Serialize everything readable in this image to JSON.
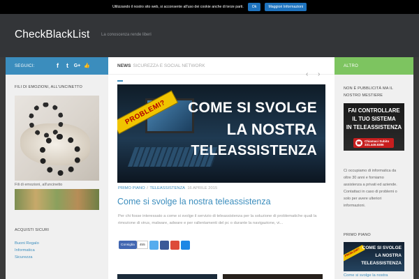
{
  "cookie": {
    "text": "Utilizzando il nostro sito web, si acconsente all'uso dei cookie anche di terze parti.",
    "ok_label": "Ok",
    "more_label": "Maggiori Informazioni"
  },
  "header": {
    "site_title": "CheckBlackList",
    "tagline": "La conoscenza rende liberi"
  },
  "left_sidebar": {
    "follow_label": "SEGUICI:",
    "social_icons": [
      "facebook-icon",
      "twitter-icon",
      "google-plus-icon",
      "thumbs-up-icon"
    ],
    "social_glyphs": [
      "f",
      "t",
      "G+",
      "👍"
    ],
    "widget1_title": "FILI DI EMOZIONI, ALL'UNCINETTO",
    "widget1_caption": "Fili di emozioni, all'uncinetto",
    "widget2_title": "ACQUISTI SICURI",
    "links": [
      "Buoni Regalo",
      "Informatica",
      "Sicurezza"
    ]
  },
  "main": {
    "news_label": "NEWS",
    "news_sub": "SICUREZZA E SOCIAL NETWORK",
    "featured_image": {
      "banner": "PROBLEMI?",
      "line1": "COME SI SVOLGE",
      "line2": "LA NOSTRA",
      "line3": "TELEASSISTENZA"
    },
    "post": {
      "category1": "PRIMO PIANO",
      "separator": "/",
      "category2": "TELEASSISTENZA",
      "date": "16 APRILE 2015",
      "title": "Come si svolge la nostra teleassistenza",
      "excerpt": "Per chi fosse interessato a come si svolge il servizio di teleassistenza per la soluzione di problematiche quali la rimozione di virus, malware, adware e per rallentamenti del pc o durante la navigazione, vi..."
    },
    "share": {
      "like_label": "Consiglia",
      "like_count": "455"
    }
  },
  "right_sidebar": {
    "head_label": "ALTRO",
    "ad_title_line1": "NON È PUBBLICITÀ MA IL",
    "ad_title_line2": "NOSTRO MESTIERE",
    "ad": {
      "line1": "FAI CONTROLLARE",
      "line2": "IL TUO SISTEMA",
      "line3": "IN TELEASSISTENZA",
      "call_label": "Chiamaci Subito",
      "phone": "331.449.8386"
    },
    "text_lines": [
      "Ci occupiamo di informatica da",
      "oltre 30 anni e forniamo",
      "assistenza a privati ed aziende.",
      "Contattaci in caso di problemi o",
      "solo per avere ulteriori",
      "informazioni."
    ],
    "section2_title": "PRIMO PIANO",
    "thumb": {
      "banner": "PROBLEMI?",
      "line1": "COME SI SVOLGE",
      "line2": "LA NOSTRA",
      "line3": "TELEASSISTENZA"
    },
    "thumb_link": "Come si svolge la nostra"
  },
  "colors": {
    "blue_accent": "#3b8dbd",
    "green_accent": "#7dc460",
    "header_bg": "#333538"
  }
}
